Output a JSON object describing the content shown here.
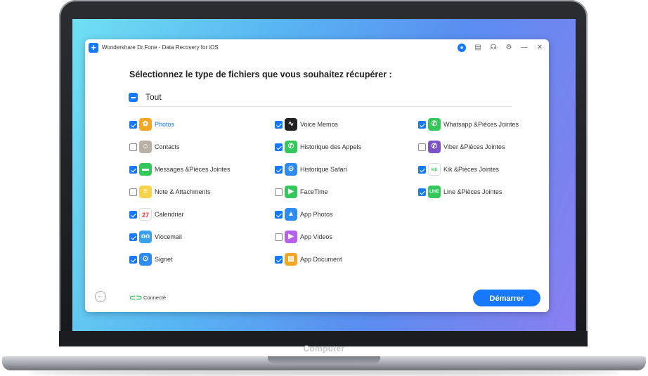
{
  "device": {
    "brand": "Computer"
  },
  "window": {
    "title": "Wondershare Dr.Fone - Data Recovery for iOS"
  },
  "heading": "Sélectionnez le type de fichiers que vous souhaitez récupérer :",
  "select_all": {
    "label": "Tout",
    "state": "indeterminate"
  },
  "columns": [
    [
      {
        "label": "Photos",
        "checked": true,
        "icon": "photos-icon",
        "color": "#f5a623",
        "glyph": "✿",
        "highlight": true
      },
      {
        "label": "Contacts",
        "checked": false,
        "icon": "contacts-icon",
        "color": "#b9b1a4",
        "glyph": "☺"
      },
      {
        "label": "Messages &Pièces Jointes",
        "checked": true,
        "icon": "messages-icon",
        "color": "#34c759",
        "glyph": "▬"
      },
      {
        "label": "Note & Attachments",
        "checked": false,
        "icon": "notes-icon",
        "color": "#f7d34b",
        "glyph": "≡"
      },
      {
        "label": "Calendrier",
        "checked": true,
        "icon": "calendar-icon",
        "color": "#ffffff",
        "glyph": "27"
      },
      {
        "label": "Viocemail",
        "checked": true,
        "icon": "voicemail-icon",
        "color": "#3aa0f0",
        "glyph": "oo"
      },
      {
        "label": "Signet",
        "checked": true,
        "icon": "bookmark-icon",
        "color": "#2f8cf0",
        "glyph": "⊙"
      }
    ],
    [
      {
        "label": "Voice Memos",
        "checked": true,
        "icon": "voice-memos-icon",
        "color": "#222222",
        "glyph": "∿"
      },
      {
        "label": "Historique des Appels",
        "checked": true,
        "icon": "phone-icon",
        "color": "#34c759",
        "glyph": "✆"
      },
      {
        "label": "Historique Safari",
        "checked": true,
        "icon": "safari-icon",
        "color": "#2f8cf0",
        "glyph": "⊙"
      },
      {
        "label": "FaceTime",
        "checked": false,
        "icon": "facetime-icon",
        "color": "#34c759",
        "glyph": "▶"
      },
      {
        "label": "App Photos",
        "checked": true,
        "icon": "app-photos-icon",
        "color": "#2f8cf0",
        "glyph": "▲"
      },
      {
        "label": "App Videos",
        "checked": false,
        "icon": "app-videos-icon",
        "color": "#b760f0",
        "glyph": "▶"
      },
      {
        "label": "App Document",
        "checked": true,
        "icon": "app-document-icon",
        "color": "#f5a623",
        "glyph": "▤"
      }
    ],
    [
      {
        "label": "Whatsapp &Pièces Jointes",
        "checked": true,
        "icon": "whatsapp-icon",
        "color": "#34c759",
        "glyph": "✆"
      },
      {
        "label": "Viber &Pièces Jointes",
        "checked": false,
        "icon": "viber-icon",
        "color": "#7b52c7",
        "glyph": "✆"
      },
      {
        "label": "Kik &Pièces Jointes",
        "checked": true,
        "icon": "kik-icon",
        "color": "#ffffff",
        "glyph": "kik"
      },
      {
        "label": "Line &Pièces Jointes",
        "checked": true,
        "icon": "line-icon",
        "color": "#34c759",
        "glyph": "LINE"
      }
    ]
  ],
  "footer": {
    "status": "Connecté",
    "start_label": "Démarrer"
  }
}
